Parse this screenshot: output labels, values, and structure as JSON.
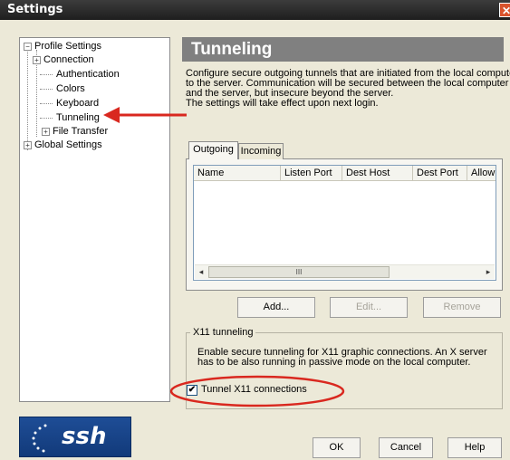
{
  "window": {
    "title": "Settings",
    "close_glyph": "✕"
  },
  "tree": {
    "items": [
      {
        "label": "Profile Settings",
        "expander": "−"
      },
      {
        "label": "Connection",
        "expander": "+"
      },
      {
        "label": "Authentication"
      },
      {
        "label": "Colors"
      },
      {
        "label": "Keyboard"
      },
      {
        "label": "Tunneling"
      },
      {
        "label": "File Transfer",
        "expander": "+"
      },
      {
        "label": "Global Settings",
        "expander": "+"
      }
    ]
  },
  "header": {
    "title": "Tunneling"
  },
  "description": {
    "lines": [
      "Configure secure outgoing tunnels that are initiated from the local computer",
      "to the server. Communication will be secured between the local computer",
      "and the server, but insecure beyond the server.",
      "The settings will take effect upon next login."
    ]
  },
  "tabs": [
    {
      "label": "Outgoing"
    },
    {
      "label": "Incoming"
    }
  ],
  "tunnels_table": {
    "columns": [
      "Name",
      "Listen Port",
      "Dest Host",
      "Dest Port",
      "Allow"
    ],
    "rows": [],
    "scroll_thumb_glyph": "III",
    "scroll_left_glyph": "◂",
    "scroll_right_glyph": "▸"
  },
  "buttons": {
    "add": "Add...",
    "edit": "Edit...",
    "remove": "Remove"
  },
  "x11": {
    "group_label": "X11 tunneling",
    "description_lines": [
      "Enable secure tunneling for X11 graphic connections. An X server",
      "has to be also running in passive mode on the local computer."
    ],
    "checkbox_label": "Tunnel X11 connections",
    "checked": true,
    "check_glyph": "✔"
  },
  "footer": {
    "ok": "OK",
    "cancel": "Cancel",
    "help": "Help"
  },
  "logo": {
    "text": "ssh"
  },
  "colors": {
    "annotation_red": "#d9281f",
    "header_bg": "#808080"
  }
}
